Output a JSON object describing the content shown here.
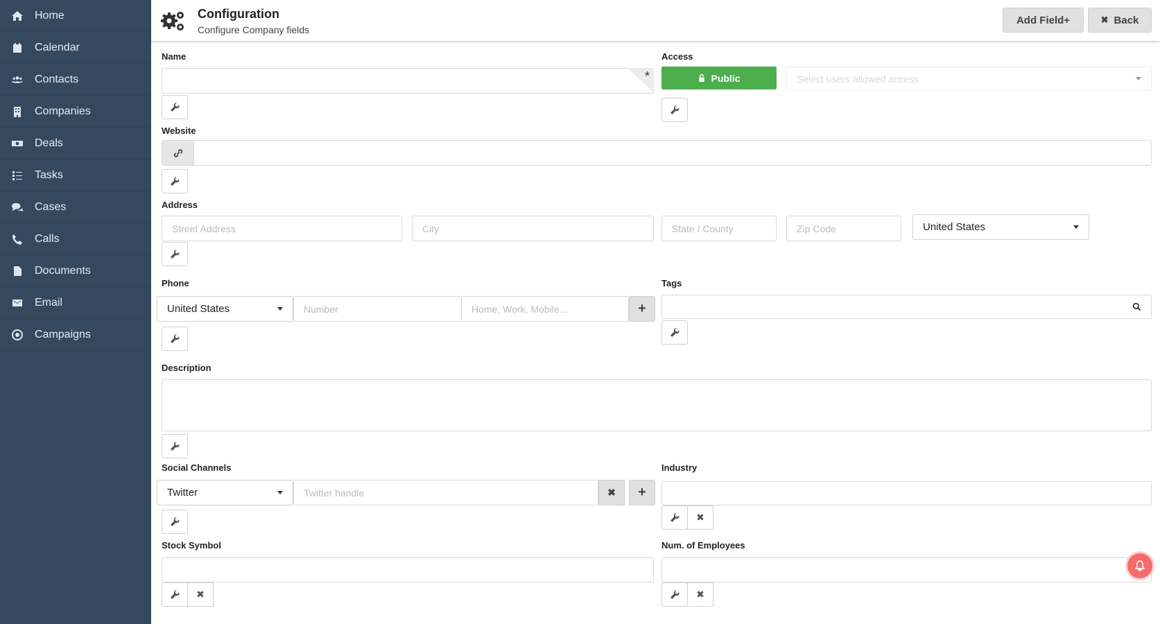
{
  "sidebar": {
    "items": [
      {
        "label": "Home",
        "icon": "home-icon"
      },
      {
        "label": "Calendar",
        "icon": "calendar-icon"
      },
      {
        "label": "Contacts",
        "icon": "users-icon"
      },
      {
        "label": "Companies",
        "icon": "building-icon"
      },
      {
        "label": "Deals",
        "icon": "money-icon"
      },
      {
        "label": "Tasks",
        "icon": "tasks-icon"
      },
      {
        "label": "Cases",
        "icon": "comments-icon"
      },
      {
        "label": "Calls",
        "icon": "phone-icon"
      },
      {
        "label": "Documents",
        "icon": "file-icon"
      },
      {
        "label": "Email",
        "icon": "envelope-icon"
      },
      {
        "label": "Campaigns",
        "icon": "bullseye-icon"
      }
    ]
  },
  "header": {
    "title": "Configuration",
    "subtitle": "Configure Company fields",
    "add_field_label": "Add Field+",
    "back_label": "Back",
    "back_icon": "✖"
  },
  "form": {
    "name": {
      "label": "Name",
      "required_mark": "*"
    },
    "access": {
      "label": "Access",
      "public_label": "Public",
      "users_placeholder": "Select users allowed access",
      "accent": "#4cae4c"
    },
    "website": {
      "label": "Website"
    },
    "address": {
      "label": "Address",
      "street_placeholder": "Street Address",
      "city_placeholder": "City",
      "state_placeholder": "State / County",
      "zip_placeholder": "Zip Code",
      "country_value": "United States"
    },
    "phone": {
      "label": "Phone",
      "country_value": "United States",
      "number_placeholder": "Number",
      "type_placeholder": "Home, Work, Mobile...",
      "add_icon": "+"
    },
    "tags": {
      "label": "Tags"
    },
    "description": {
      "label": "Description"
    },
    "social": {
      "label": "Social Channels",
      "channel_value": "Twitter",
      "handle_placeholder": "Twitter handle",
      "remove_icon": "✖",
      "add_icon": "+"
    },
    "industry": {
      "label": "Industry",
      "remove_icon": "✖"
    },
    "stock": {
      "label": "Stock Symbol",
      "remove_icon": "✖"
    },
    "employees": {
      "label": "Num. of Employees",
      "remove_icon": "✖"
    }
  }
}
